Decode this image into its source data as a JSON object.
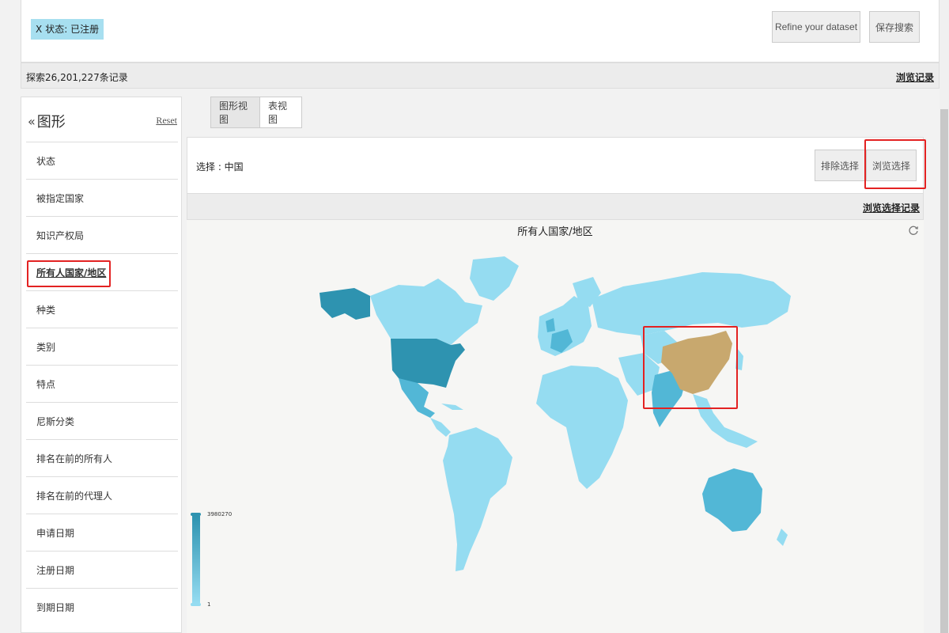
{
  "filter": {
    "tag_close": "X",
    "tag_label": "状态: 已注册"
  },
  "toolbar": {
    "refine_label": "Refine your dataset",
    "save_label": "保存搜索"
  },
  "status": {
    "count_text": "探索26,201,227条记录",
    "history_link": "浏览记录"
  },
  "sidebar": {
    "chevron": "«",
    "title": "图形",
    "reset": "Reset",
    "items": [
      {
        "label": "状态"
      },
      {
        "label": "被指定国家"
      },
      {
        "label": "知识产权局"
      },
      {
        "label": "所有人国家/地区"
      },
      {
        "label": "种类"
      },
      {
        "label": "类别"
      },
      {
        "label": "特点"
      },
      {
        "label": "尼斯分类"
      },
      {
        "label": "排名在前的所有人"
      },
      {
        "label": "排名在前的代理人"
      },
      {
        "label": "申请日期"
      },
      {
        "label": "注册日期"
      },
      {
        "label": "到期日期"
      }
    ],
    "active_index": 3
  },
  "view_tabs": {
    "graph": "图形视图",
    "table": "表视图"
  },
  "selection": {
    "label": "选择 : 中国",
    "exclude_btn": "排除选择",
    "browse_btn": "浏览选择",
    "history_link": "浏览选择记录"
  },
  "map": {
    "title": "所有人国家/地区",
    "refresh_icon": "refresh-icon",
    "legend_max": "3980270",
    "legend_min": "1",
    "colors": {
      "low": "#95dcf1",
      "mid": "#52b7d6",
      "high": "#2e93b0",
      "selected": "#c8a86e",
      "highlight": "#e32222"
    }
  }
}
